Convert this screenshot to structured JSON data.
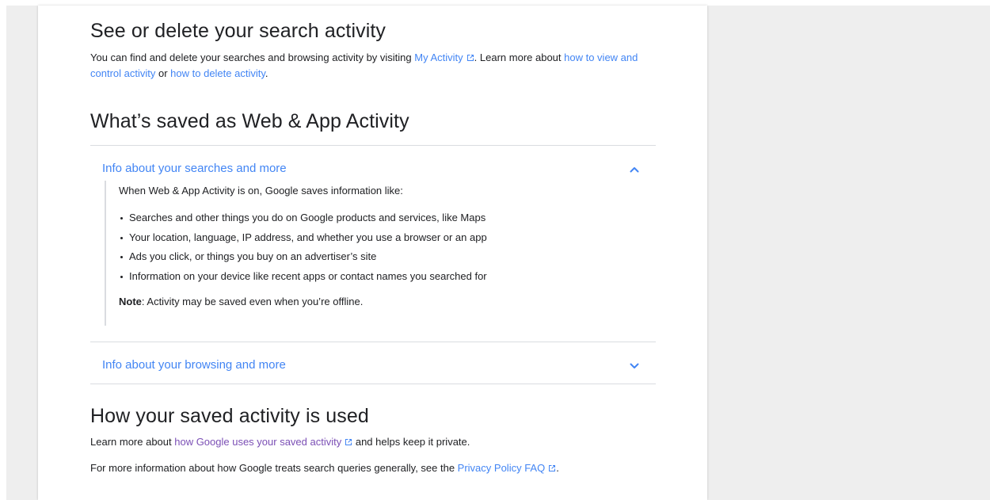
{
  "section_search": {
    "title": "See or delete your search activity",
    "text_1": "You can find and delete your searches and browsing activity by visiting ",
    "link_my_activity": "My Activity",
    "text_2": ". Learn more about ",
    "link_view_control": "how to view and control activity",
    "text_3": " or ",
    "link_delete": "how to delete activity",
    "text_4": "."
  },
  "section_saved": {
    "title": "What’s saved as Web & App Activity",
    "accordion_searches": {
      "title": "Info about your searches and more",
      "expanded": true,
      "intro": "When Web & App Activity is on, Google saves information like:",
      "items": [
        "Searches and other things you do on Google products and services, like Maps",
        "Your location, language, IP address, and whether you use a browser or an app",
        "Ads you click, or things you buy on an advertiser’s site",
        "Information on your device like recent apps or contact names you searched for"
      ],
      "note_label": "Note",
      "note_text": ": Activity may be saved even when you’re offline."
    },
    "accordion_browsing": {
      "title": "Info about your browsing and more",
      "expanded": false
    }
  },
  "section_used": {
    "title": "How your saved activity is used",
    "p1_text_1": "Learn more about ",
    "p1_link": "how Google uses your saved activity",
    "p1_text_2": " and helps keep it private.",
    "p2_text_1": "For more information about how Google treats search queries generally, see the ",
    "p2_link": "Privacy Policy FAQ",
    "p2_text_2": "."
  },
  "colors": {
    "link": "#4285f4",
    "visited_link": "#7b4fb5",
    "text": "#202124",
    "divider": "#dadce0",
    "page_background": "#eeeeee"
  },
  "icons": {
    "external_link": "open-in-new-icon",
    "expand_less": "chevron-up-icon",
    "expand_more": "chevron-down-icon"
  }
}
